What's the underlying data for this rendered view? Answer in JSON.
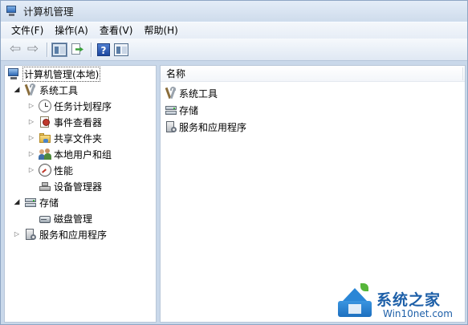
{
  "window": {
    "title": "计算机管理"
  },
  "menu": [
    "文件(F)",
    "操作(A)",
    "查看(V)",
    "帮助(H)"
  ],
  "toolbar": {
    "icons": [
      "back-arrow-icon",
      "forward-arrow-icon",
      "show-hide-console-tree-icon",
      "export-list-icon",
      "help-icon",
      "show-hide-action-pane-icon"
    ]
  },
  "tree": {
    "root": "计算机管理(本地)",
    "system_tools": "系统工具",
    "task_scheduler": "任务计划程序",
    "event_viewer": "事件查看器",
    "shared_folders": "共享文件夹",
    "local_users": "本地用户和组",
    "performance": "性能",
    "device_manager": "设备管理器",
    "storage": "存储",
    "disk_management": "磁盘管理",
    "services_apps": "服务和应用程序"
  },
  "list": {
    "column_name": "名称",
    "items": [
      "系统工具",
      "存储",
      "服务和应用程序"
    ]
  },
  "watermark": {
    "brand": "系统之家",
    "site": "Win10net.com"
  }
}
